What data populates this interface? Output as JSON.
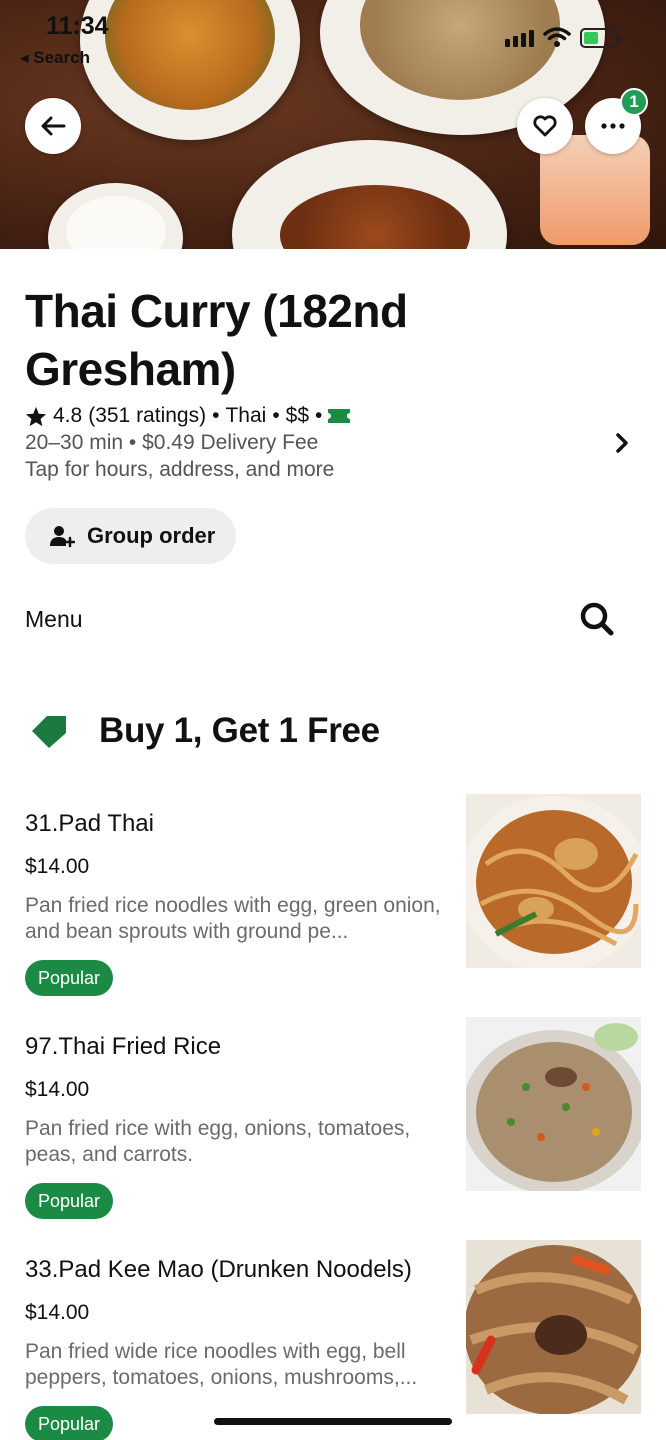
{
  "status_bar": {
    "time": "11:34",
    "back_app": "◂ Search"
  },
  "hero": {
    "cart_count": "1"
  },
  "restaurant": {
    "name": "Thai Curry (182nd Gresham)",
    "rating": "4.8",
    "ratings_count": "(351 ratings)",
    "cuisine": "Thai",
    "price_range": "$$",
    "delivery_time": "20–30 min",
    "delivery_fee": "$0.49 Delivery Fee",
    "info_hint": "Tap for hours, address, and more"
  },
  "actions": {
    "group_order": "Group order"
  },
  "menu": {
    "label": "Menu"
  },
  "promo": {
    "title": "Buy 1, Get 1 Free"
  },
  "items": [
    {
      "name": "31.Pad Thai",
      "price": "$14.00",
      "desc": "Pan fried rice noodles with egg, green onion, and bean sprouts with ground pe...",
      "tag": "Popular"
    },
    {
      "name": "97.Thai Fried Rice",
      "price": "$14.00",
      "desc": "Pan fried rice with egg, onions, tomatoes, peas, and carrots.",
      "tag": "Popular"
    },
    {
      "name": "33.Pad Kee Mao (Drunken Noodels)",
      "price": "$14.00",
      "desc": "Pan fried wide rice noodles with egg, bell peppers, tomatoes, onions, mushrooms,...",
      "tag": "Popular"
    }
  ],
  "colors": {
    "accent_green": "#1b8a45",
    "chip_bg": "#eeeeee",
    "secondary_text": "#545454"
  }
}
